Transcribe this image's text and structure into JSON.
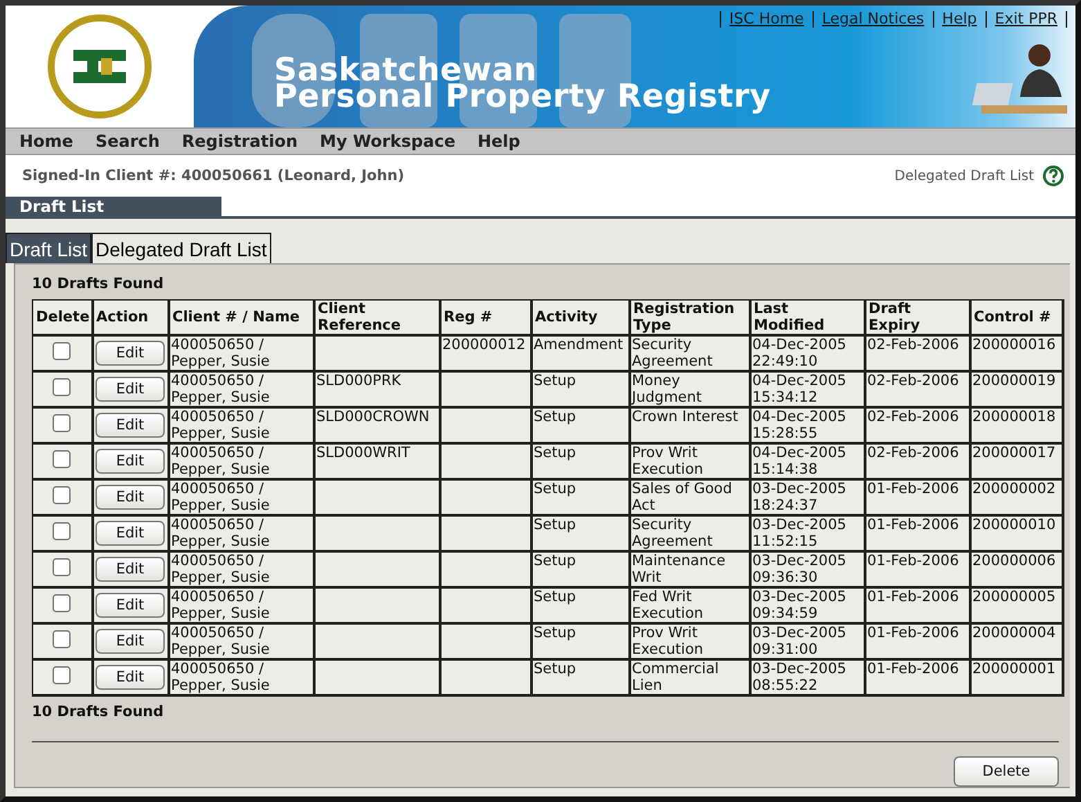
{
  "header": {
    "title_lines": [
      "Saskatchewan",
      "Personal Property Registry"
    ],
    "links": [
      "ISC Home",
      "Legal Notices",
      "Help",
      "Exit PPR"
    ]
  },
  "menu": [
    "Home",
    "Search",
    "Registration",
    "My Workspace",
    "Help"
  ],
  "signed_in": "Signed-In Client #: 400050661 (Leonard, John)",
  "delegated_link": "Delegated Draft List",
  "section_title": "Draft List",
  "tabs": [
    {
      "label": "Draft List",
      "selected": true
    },
    {
      "label": "Delegated Draft List",
      "selected": false
    }
  ],
  "count_top": "10 Drafts Found",
  "table": {
    "columns": [
      "Delete",
      "Action",
      "Client # / Name",
      "Client Reference",
      "Reg #",
      "Activity",
      "Registration Type",
      "Last Modified",
      "Draft Expiry",
      "Control #"
    ],
    "rows": [
      {
        "checked": false,
        "action": "Edit",
        "client": "400050650 / Pepper, Susie",
        "reference": "",
        "reg": "200000012",
        "activity": "Amendment",
        "type": "Security Agreement",
        "modified": "04-Dec-2005 22:49:10",
        "expiry": "02-Feb-2006",
        "control": "200000016"
      },
      {
        "checked": false,
        "action": "Edit",
        "client": "400050650 / Pepper, Susie",
        "reference": "SLD000PRK",
        "reg": "",
        "activity": "Setup",
        "type": "Money Judgment",
        "modified": "04-Dec-2005 15:34:12",
        "expiry": "02-Feb-2006",
        "control": "200000019"
      },
      {
        "checked": false,
        "action": "Edit",
        "client": "400050650 / Pepper, Susie",
        "reference": "SLD000CROWN",
        "reg": "",
        "activity": "Setup",
        "type": "Crown Interest",
        "modified": "04-Dec-2005 15:28:55",
        "expiry": "02-Feb-2006",
        "control": "200000018"
      },
      {
        "checked": false,
        "action": "Edit",
        "client": "400050650 / Pepper, Susie",
        "reference": "SLD000WRIT",
        "reg": "",
        "activity": "Setup",
        "type": "Prov Writ Execution",
        "modified": "04-Dec-2005 15:14:38",
        "expiry": "02-Feb-2006",
        "control": "200000017"
      },
      {
        "checked": false,
        "action": "Edit",
        "client": "400050650 / Pepper, Susie",
        "reference": "",
        "reg": "",
        "activity": "Setup",
        "type": "Sales of Good Act",
        "modified": "03-Dec-2005 18:24:37",
        "expiry": "01-Feb-2006",
        "control": "200000002"
      },
      {
        "checked": false,
        "action": "Edit",
        "client": "400050650 / Pepper, Susie",
        "reference": "",
        "reg": "",
        "activity": "Setup",
        "type": "Security Agreement",
        "modified": "03-Dec-2005 11:52:15",
        "expiry": "01-Feb-2006",
        "control": "200000010"
      },
      {
        "checked": false,
        "action": "Edit",
        "client": "400050650 / Pepper, Susie",
        "reference": "",
        "reg": "",
        "activity": "Setup",
        "type": "Maintenance Writ",
        "modified": "03-Dec-2005 09:36:30",
        "expiry": "01-Feb-2006",
        "control": "200000006"
      },
      {
        "checked": false,
        "action": "Edit",
        "client": "400050650 / Pepper, Susie",
        "reference": "",
        "reg": "",
        "activity": "Setup",
        "type": "Fed Writ Execution",
        "modified": "03-Dec-2005 09:34:59",
        "expiry": "01-Feb-2006",
        "control": "200000005"
      },
      {
        "checked": false,
        "action": "Edit",
        "client": "400050650 / Pepper, Susie",
        "reference": "",
        "reg": "",
        "activity": "Setup",
        "type": "Prov Writ Execution",
        "modified": "03-Dec-2005 09:31:00",
        "expiry": "01-Feb-2006",
        "control": "200000004"
      },
      {
        "checked": false,
        "action": "Edit",
        "client": "400050650 / Pepper, Susie",
        "reference": "",
        "reg": "",
        "activity": "Setup",
        "type": "Commercial Lien",
        "modified": "03-Dec-2005 08:55:22",
        "expiry": "01-Feb-2006",
        "control": "200000001"
      }
    ]
  },
  "count_bottom": "10 Drafts Found",
  "delete_button": "Delete"
}
